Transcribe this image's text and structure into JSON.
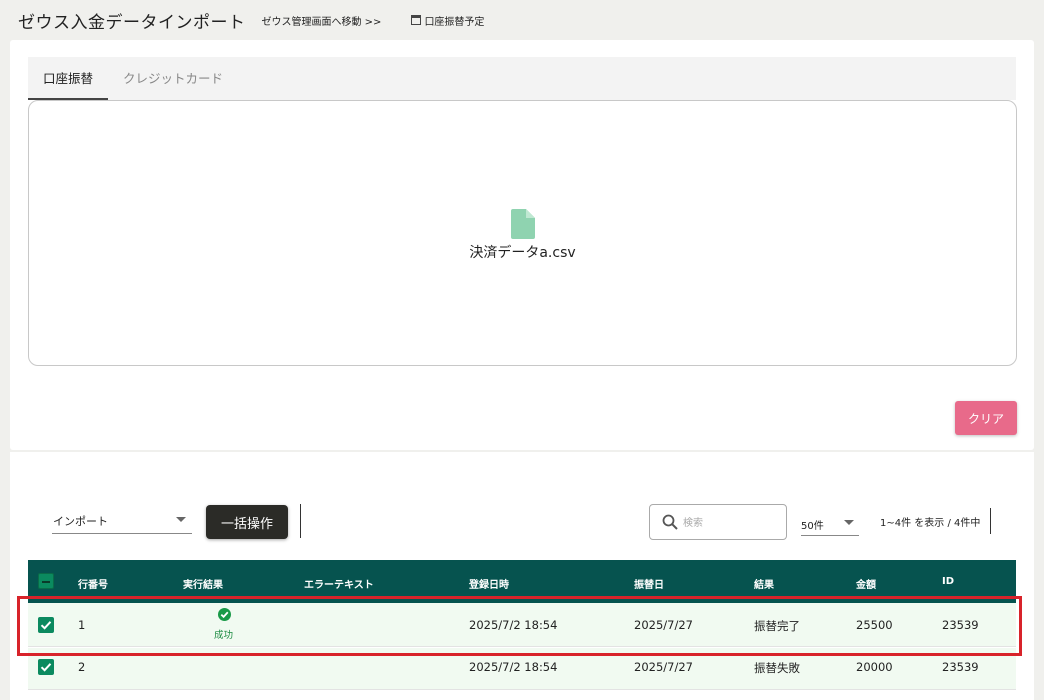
{
  "header": {
    "title": "ゼウス入金データインポート",
    "nav_link": "ゼウス管理画面へ移動 >>",
    "schedule_link": "口座振替予定"
  },
  "upload": {
    "tabs": [
      {
        "label": "口座振替",
        "active": true
      },
      {
        "label": "クレジットカード",
        "active": false
      }
    ],
    "file_name": "決済データa.csv",
    "clear_label": "クリア",
    "file_icon_color": "#8fd3b0"
  },
  "toolbar": {
    "import_select": "インポート",
    "bulk_label": "一括操作",
    "search_placeholder": "検索",
    "per_page": "50件",
    "range_text": "1~4件 を表示 / 4件中"
  },
  "table": {
    "header_bg": "#06534f",
    "columns": [
      "行番号",
      "実行結果",
      "エラーテキスト",
      "登録日時",
      "振替日",
      "結果",
      "金額",
      "ID"
    ],
    "rows": [
      {
        "row_no": "1",
        "status": "成功",
        "error": "",
        "registered": "2025/7/2 18:54",
        "transfer_date": "2025/7/27",
        "result": "振替完了",
        "amount": "25500",
        "id": "23539"
      },
      {
        "row_no": "2",
        "status": "",
        "error": "",
        "registered": "2025/7/2 18:54",
        "transfer_date": "2025/7/27",
        "result": "振替失敗",
        "amount": "20000",
        "id": "23539"
      }
    ]
  },
  "highlight_color": "#d8232a"
}
